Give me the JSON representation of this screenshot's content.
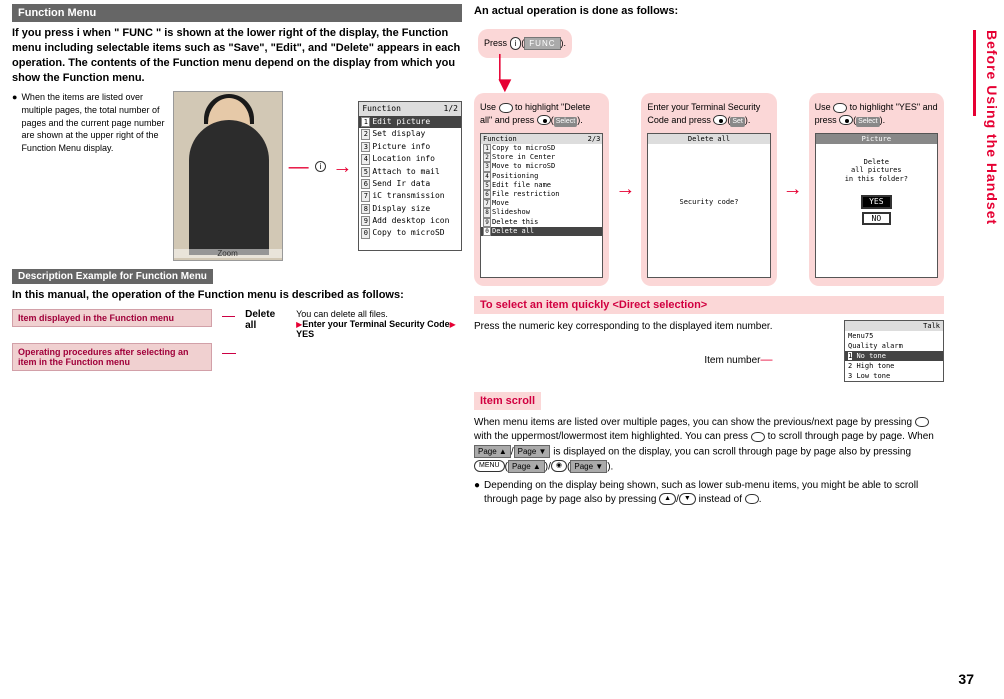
{
  "left": {
    "title": "Function Menu",
    "intro": "If you press i when \" FUNC \" is shown at the lower right of the display, the Function menu including selectable items such as \"Save\", \"Edit\", and \"Delete\" appears in each operation. The contents of the Function menu depend on the display from which you show the Function menu.",
    "bullet1": "When the items are listed over multiple pages, the total number of pages and the current page number are shown at the upper right of the Function Menu display.",
    "ir_label": "i",
    "zoom_label": "Zoom",
    "menu1": {
      "head_l": "Function",
      "head_r": "1/2",
      "rows": [
        "Edit picture",
        "Set display",
        "Picture info",
        "Location info",
        "Attach to mail",
        "Send Ir data",
        "iC transmission",
        "Display size",
        "Add desktop icon",
        "Copy to microSD"
      ]
    },
    "desc_title": "Description Example for Function Menu",
    "desc_para": "In this manual, the operation of the Function menu is described as follows:",
    "box1": "Item displayed in the Function menu",
    "box2": "Operating procedures after selecting an item in the Function menu",
    "func_item": "Delete all",
    "func_text1": "You can delete all files.",
    "func_text2_pre": "Enter your Terminal Security Code",
    "func_text2_post": "YES"
  },
  "right": {
    "actual_title": "An actual operation is done as follows:",
    "step_press_pre": "Press ",
    "step_press_icon": "i",
    "step_press_func": "FUNC",
    "step_press_post": ").",
    "step2_a": "Use ",
    "step2_b": " to highlight \"Delete all\" and press ",
    "step2_btn": "Select",
    "step3_a": "Enter your Terminal Security Code and press ",
    "step3_btn": "Set",
    "step4_a": "Use ",
    "step4_b": " to highlight \"YES\" and press ",
    "step4_btn": "Select",
    "menu2": {
      "head_l": "Function",
      "head_r": "2/3",
      "rows": [
        "Copy to microSD",
        "Store in Center",
        "Move to microSD",
        "Positioning",
        "Edit file name",
        "File restriction",
        "Move",
        "Slideshow",
        "Delete this",
        "Delete all"
      ]
    },
    "delall_head": "Delete all",
    "delall_prompt": "Security code?",
    "pic_head": "Picture",
    "pic_prompt": "Delete\nall pictures\nin this folder?",
    "yes": "YES",
    "no": "NO",
    "direct_title": "To select an item quickly <Direct selection>",
    "direct_p": "Press the numeric key corresponding to the displayed item number.",
    "item_num_label": "Item number",
    "talk": {
      "hdr_l": "",
      "hdr_r": "Talk",
      "menu": "Menu75",
      "sub": "Quality alarm",
      "rows": [
        "No tone",
        "High tone",
        "Low tone"
      ]
    },
    "scroll_title": "Item scroll",
    "scroll_p1_a": "When menu items are listed over multiple pages, you can show the previous/next page by pressing ",
    "scroll_p1_b": " with the uppermost/lowermost item highlighted. You can press ",
    "scroll_p1_c": " to scroll through page by page. When ",
    "page_up": "Page ▲",
    "page_dn": "Page ▼",
    "scroll_p1_d": " is displayed on the display, you can scroll through page by page also by pressing ",
    "menu_btn": "MENU",
    "cam_btn": "◉",
    "scroll_p1_e": ").",
    "scroll_b_a": "Depending on the display being shown, such as lower sub-menu items, you might be able to scroll through page by page also by pressing ",
    "up_tri": "▲",
    "dn_tri": "▼",
    "scroll_b_b": " instead of ",
    "scroll_b_c": "."
  },
  "side": "Before Using the Handset",
  "page_number": "37"
}
